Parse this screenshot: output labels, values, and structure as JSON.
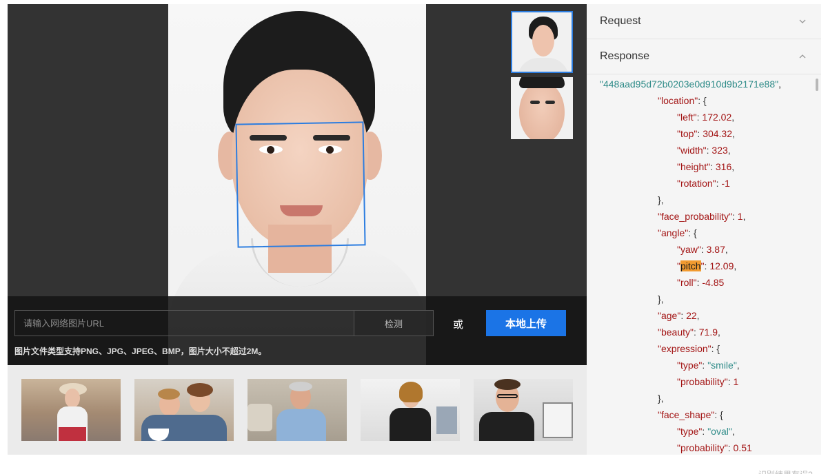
{
  "input": {
    "placeholder": "请输入网络图片URL"
  },
  "buttons": {
    "detect": "检测",
    "or": "或",
    "upload": "本地上传"
  },
  "hint": "图片文件类型支持PNG、JPG、JPEG、BMP，图片大小不超过2M。",
  "panel": {
    "request_label": "Request",
    "response_label": "Response",
    "lines": [
      {
        "indent": 0,
        "parts": [
          {
            "t": "\"448aad95d72b0203e0d910d9b2171e88\"",
            "c": "s"
          },
          {
            "t": ",",
            "c": ""
          }
        ]
      },
      {
        "indent": 1,
        "parts": [
          {
            "t": "\"location\"",
            "c": "k"
          },
          {
            "t": ": {",
            "c": ""
          }
        ]
      },
      {
        "indent": 2,
        "parts": [
          {
            "t": "\"left\"",
            "c": "k"
          },
          {
            "t": ": ",
            "c": ""
          },
          {
            "t": "172.02",
            "c": "n"
          },
          {
            "t": ",",
            "c": ""
          }
        ]
      },
      {
        "indent": 2,
        "parts": [
          {
            "t": "\"top\"",
            "c": "k"
          },
          {
            "t": ": ",
            "c": ""
          },
          {
            "t": "304.32",
            "c": "n"
          },
          {
            "t": ",",
            "c": ""
          }
        ]
      },
      {
        "indent": 2,
        "parts": [
          {
            "t": "\"width\"",
            "c": "k"
          },
          {
            "t": ": ",
            "c": ""
          },
          {
            "t": "323",
            "c": "n"
          },
          {
            "t": ",",
            "c": ""
          }
        ]
      },
      {
        "indent": 2,
        "parts": [
          {
            "t": "\"height\"",
            "c": "k"
          },
          {
            "t": ": ",
            "c": ""
          },
          {
            "t": "316",
            "c": "n"
          },
          {
            "t": ",",
            "c": ""
          }
        ]
      },
      {
        "indent": 2,
        "parts": [
          {
            "t": "\"rotation\"",
            "c": "k"
          },
          {
            "t": ": ",
            "c": ""
          },
          {
            "t": "-1",
            "c": "n"
          }
        ]
      },
      {
        "indent": 1,
        "parts": [
          {
            "t": "},",
            "c": ""
          }
        ]
      },
      {
        "indent": 1,
        "parts": [
          {
            "t": "\"face_probability\"",
            "c": "k"
          },
          {
            "t": ": ",
            "c": ""
          },
          {
            "t": "1",
            "c": "n"
          },
          {
            "t": ",",
            "c": ""
          }
        ]
      },
      {
        "indent": 1,
        "parts": [
          {
            "t": "\"angle\"",
            "c": "k"
          },
          {
            "t": ": {",
            "c": ""
          }
        ]
      },
      {
        "indent": 2,
        "parts": [
          {
            "t": "\"yaw\"",
            "c": "k"
          },
          {
            "t": ": ",
            "c": ""
          },
          {
            "t": "3.87",
            "c": "n"
          },
          {
            "t": ",",
            "c": ""
          }
        ]
      },
      {
        "indent": 2,
        "parts": [
          {
            "t": "\"",
            "c": "k"
          },
          {
            "t": "pitch",
            "c": "hl"
          },
          {
            "t": "\"",
            "c": "k"
          },
          {
            "t": ": ",
            "c": ""
          },
          {
            "t": "12.09",
            "c": "n"
          },
          {
            "t": ",",
            "c": ""
          }
        ]
      },
      {
        "indent": 2,
        "parts": [
          {
            "t": "\"roll\"",
            "c": "k"
          },
          {
            "t": ": ",
            "c": ""
          },
          {
            "t": "-4.85",
            "c": "n"
          }
        ]
      },
      {
        "indent": 1,
        "parts": [
          {
            "t": "},",
            "c": ""
          }
        ]
      },
      {
        "indent": 1,
        "parts": [
          {
            "t": "\"age\"",
            "c": "k"
          },
          {
            "t": ": ",
            "c": ""
          },
          {
            "t": "22",
            "c": "n"
          },
          {
            "t": ",",
            "c": ""
          }
        ]
      },
      {
        "indent": 1,
        "parts": [
          {
            "t": "\"beauty\"",
            "c": "k"
          },
          {
            "t": ": ",
            "c": ""
          },
          {
            "t": "71.9",
            "c": "n"
          },
          {
            "t": ",",
            "c": ""
          }
        ]
      },
      {
        "indent": 1,
        "parts": [
          {
            "t": "\"expression\"",
            "c": "k"
          },
          {
            "t": ": {",
            "c": ""
          }
        ]
      },
      {
        "indent": 2,
        "parts": [
          {
            "t": "\"type\"",
            "c": "k"
          },
          {
            "t": ": ",
            "c": ""
          },
          {
            "t": "\"smile\"",
            "c": "s"
          },
          {
            "t": ",",
            "c": ""
          }
        ]
      },
      {
        "indent": 2,
        "parts": [
          {
            "t": "\"probability\"",
            "c": "k"
          },
          {
            "t": ": ",
            "c": ""
          },
          {
            "t": "1",
            "c": "n"
          }
        ]
      },
      {
        "indent": 1,
        "parts": [
          {
            "t": "},",
            "c": ""
          }
        ]
      },
      {
        "indent": 1,
        "parts": [
          {
            "t": "\"face_shape\"",
            "c": "k"
          },
          {
            "t": ": {",
            "c": ""
          }
        ]
      },
      {
        "indent": 2,
        "parts": [
          {
            "t": "\"type\"",
            "c": "k"
          },
          {
            "t": ": ",
            "c": ""
          },
          {
            "t": "\"oval\"",
            "c": "s"
          },
          {
            "t": ",",
            "c": ""
          }
        ]
      },
      {
        "indent": 2,
        "parts": [
          {
            "t": "\"probability\"",
            "c": "k"
          },
          {
            "t": ": ",
            "c": ""
          },
          {
            "t": "0.51",
            "c": "n"
          }
        ]
      }
    ]
  },
  "footer_text": "识别结果有误?",
  "colors": {
    "accent": "#1b74e6",
    "face_box": "#2c7de0",
    "json_key": "#a31515",
    "json_string": "#2e8b88",
    "highlight": "#f29b30"
  }
}
